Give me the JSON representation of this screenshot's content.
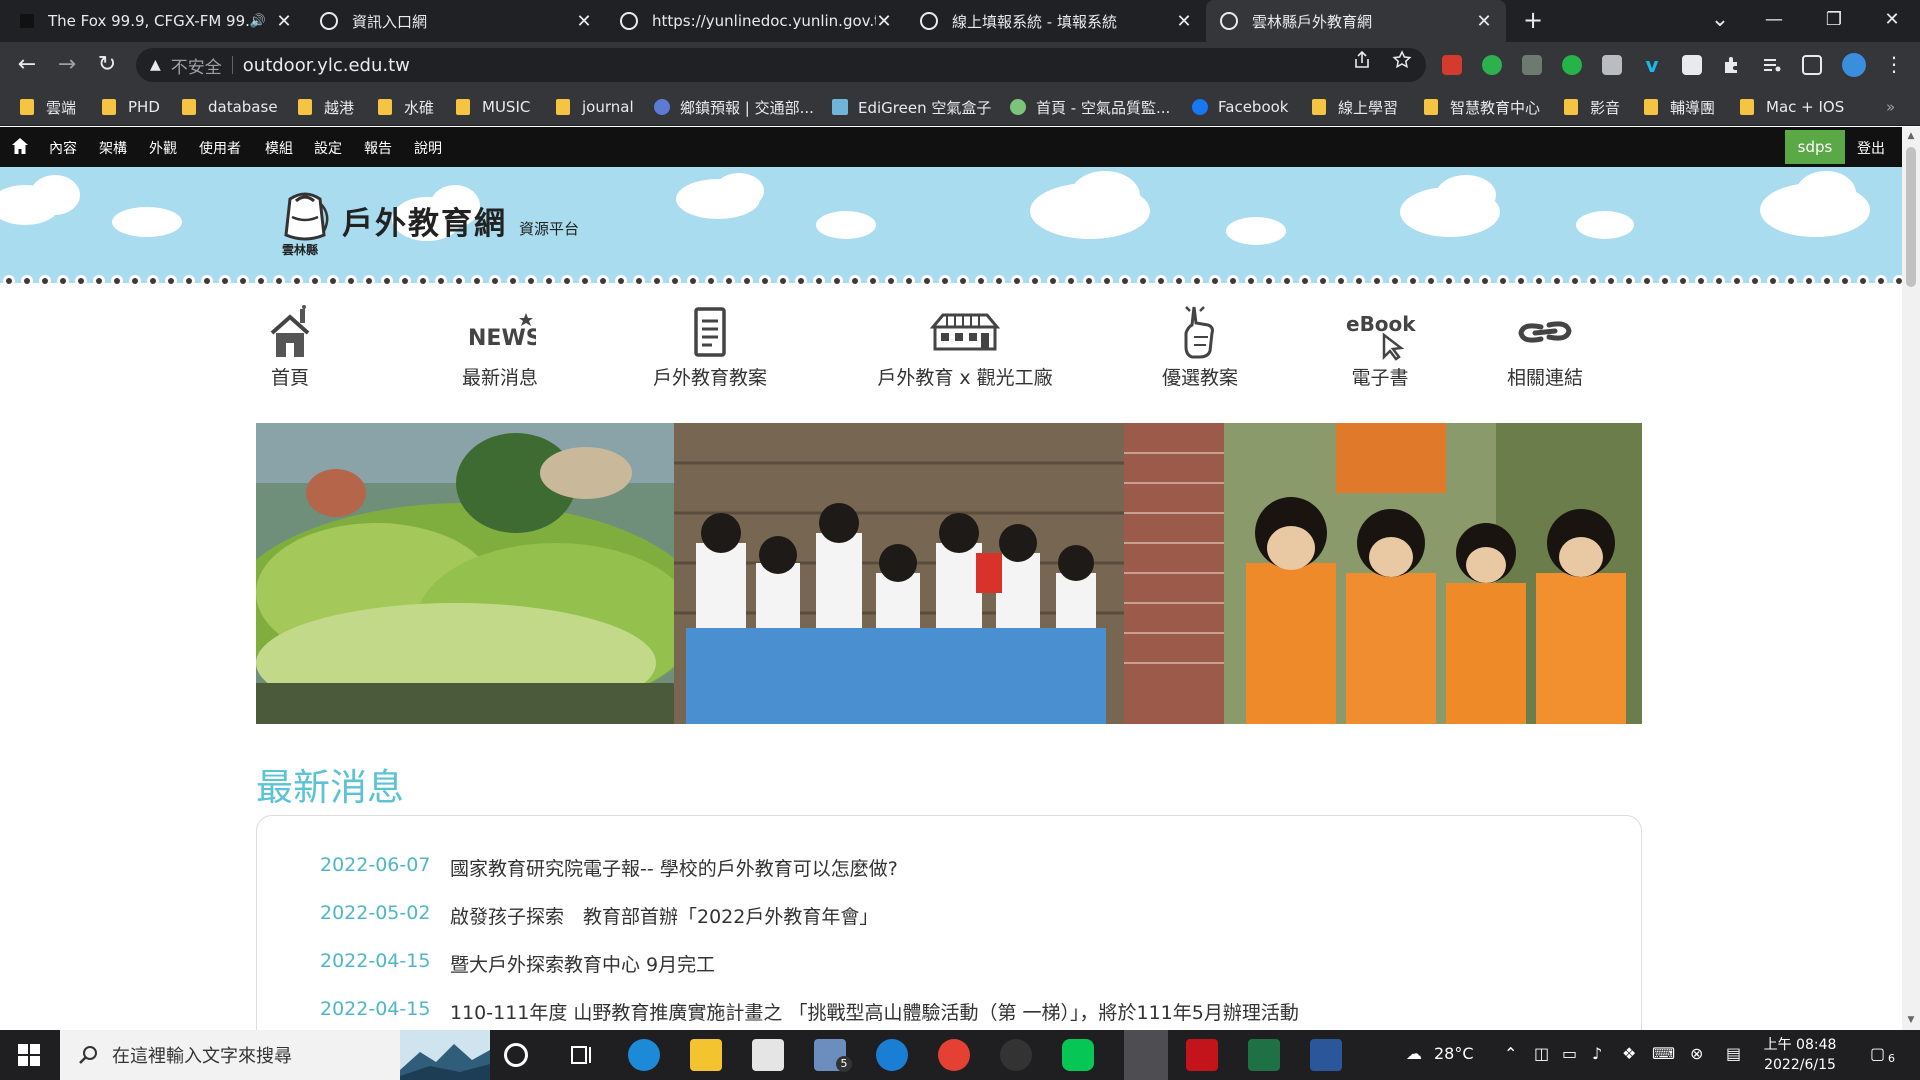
{
  "browser": {
    "tabs": [
      {
        "title": "The Fox 99.9, CFGX-FM 99.9",
        "audio": "🔊"
      },
      {
        "title": "資訊入口網"
      },
      {
        "title": "https://yunlinedoc.yunlin.gov.tw"
      },
      {
        "title": "線上填報系統 - 填報系統"
      },
      {
        "title": "雲林縣戶外教育網"
      }
    ],
    "close_glyph": "✕",
    "new_tab_glyph": "+",
    "window_controls": {
      "minimize": "—",
      "restore": "❐",
      "close": "✕"
    },
    "tab_search_glyph": "⌄",
    "nav": {
      "back": "←",
      "forward": "→",
      "reload": "↻"
    },
    "omnibox": {
      "security_label": "不安全",
      "url": "outdoor.ylc.edu.tw",
      "warning_glyph": "▲"
    },
    "bookmarks": [
      {
        "label": "雲端",
        "type": "folder"
      },
      {
        "label": "PHD",
        "type": "folder"
      },
      {
        "label": "database",
        "type": "folder"
      },
      {
        "label": "越港",
        "type": "folder"
      },
      {
        "label": "水碓",
        "type": "folder"
      },
      {
        "label": "MUSIC",
        "type": "folder"
      },
      {
        "label": "journal",
        "type": "folder"
      },
      {
        "label": "鄉鎮預報 | 交通部...",
        "type": "site"
      },
      {
        "label": "EdiGreen 空氣盒子",
        "type": "site"
      },
      {
        "label": "首頁 - 空氣品質監...",
        "type": "site"
      },
      {
        "label": "Facebook",
        "type": "site"
      },
      {
        "label": "線上學習",
        "type": "folder"
      },
      {
        "label": "智慧教育中心",
        "type": "folder"
      },
      {
        "label": "影音",
        "type": "folder"
      },
      {
        "label": "輔導團",
        "type": "folder"
      },
      {
        "label": "Mac + IOS",
        "type": "folder"
      }
    ],
    "bookmarks_overflow": "»"
  },
  "adminbar": {
    "items": [
      "內容",
      "架構",
      "外觀",
      "使用者",
      "模組",
      "設定",
      "報告",
      "說明"
    ],
    "user": "sdps",
    "logout": "登出"
  },
  "site": {
    "logo_county": "雲林縣",
    "logo_name": "戶外教育網",
    "logo_sub": "資源平台",
    "nav": [
      {
        "label": "首頁",
        "icon": "house-icon"
      },
      {
        "label": "最新消息",
        "icon": "news-icon"
      },
      {
        "label": "戶外教育教案",
        "icon": "document-icon"
      },
      {
        "label": "戶外教育 x 觀光工廠",
        "icon": "factory-icon"
      },
      {
        "label": "優選教案",
        "icon": "thumbs-up-icon"
      },
      {
        "label": "電子書",
        "icon": "ebook-icon"
      },
      {
        "label": "相關連結",
        "icon": "link-icon"
      }
    ],
    "news_icon_text": "NEWS",
    "ebook_icon_text": "eBook",
    "news": {
      "heading": "最新消息",
      "items": [
        {
          "date": "2022-06-07",
          "text": "國家教育研究院電子報-- 學校的戶外教育可以怎麼做?"
        },
        {
          "date": "2022-05-02",
          "text": "啟發孩子探索　教育部首辦「2022戶外教育年會」"
        },
        {
          "date": "2022-04-15",
          "text": "暨大戶外探索教育中心 9月完工"
        },
        {
          "date": "2022-04-15",
          "text": "110-111年度 山野教育推廣實施計畫之 「挑戰型高山體驗活動（第 一梯）」，將於111年5月辦理活動"
        }
      ]
    }
  },
  "taskbar": {
    "search_placeholder": "在這裡輸入文字來搜尋",
    "mail_badge": "5",
    "weather": "28°C",
    "time": "上午 08:48",
    "date": "2022/6/15",
    "notification_count": "6"
  },
  "colors": {
    "accent": "#5bc3d3",
    "date": "#4fb6c8",
    "admin_user_bg": "#5aa846",
    "sky": "#a9dcef"
  }
}
